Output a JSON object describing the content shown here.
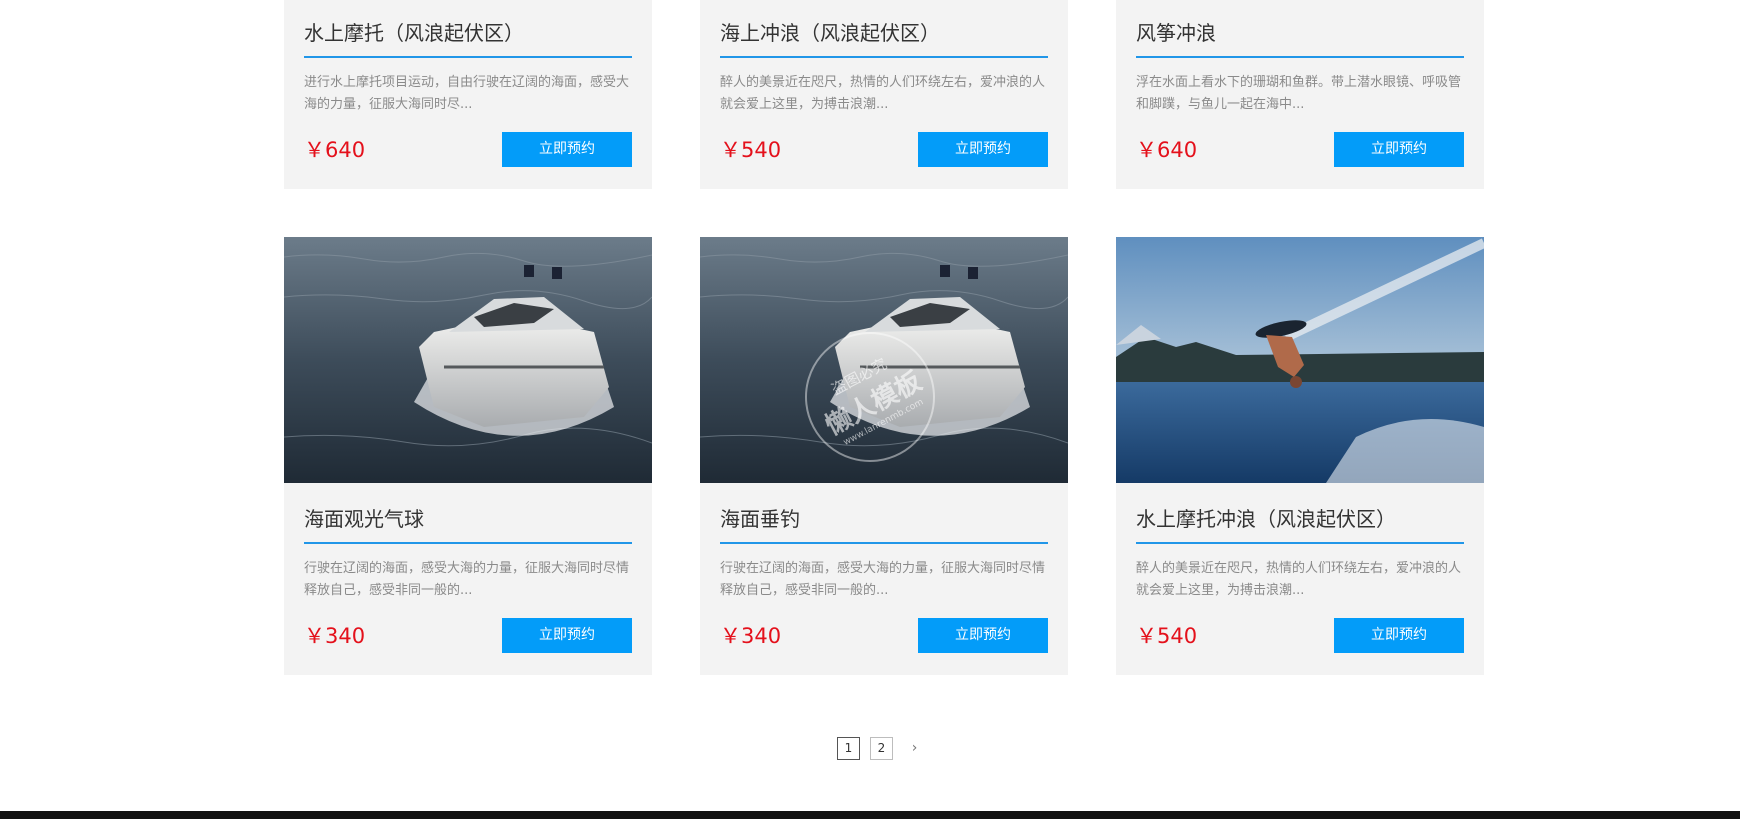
{
  "cards": [
    {
      "title": "水上摩托（风浪起伏区）",
      "desc": "进行水上摩托项目运动，自由行驶在辽阔的海面，感受大海的力量，征服大海同时尽...",
      "price": "￥640",
      "button": "立即预约"
    },
    {
      "title": "海上冲浪（风浪起伏区）",
      "desc": "醉人的美景近在咫尺，热情的人们环绕左右，爱冲浪的人就会爱上这里，为搏击浪潮...",
      "price": "￥540",
      "button": "立即预约"
    },
    {
      "title": "风筝冲浪",
      "desc": "浮在水面上看水下的珊瑚和鱼群。带上潜水眼镜、呼吸管和脚蹼，与鱼儿一起在海中...",
      "price": "￥640",
      "button": "立即预约"
    },
    {
      "title": "海面观光气球",
      "desc": "行驶在辽阔的海面，感受大海的力量，征服大海同时尽情释放自己，感受非同一般的...",
      "price": "￥340",
      "button": "立即预约"
    },
    {
      "title": "海面垂钓",
      "desc": "行驶在辽阔的海面，感受大海的力量，征服大海同时尽情释放自己，感受非同一般的...",
      "price": "￥340",
      "button": "立即预约"
    },
    {
      "title": "水上摩托冲浪（风浪起伏区）",
      "desc": "醉人的美景近在咫尺，热情的人们环绕左右，爱冲浪的人就会爱上这里，为搏击浪潮...",
      "price": "￥540",
      "button": "立即预约"
    }
  ],
  "watermark": {
    "line1": "盗图必究",
    "line2": "懒人模板",
    "line3": "www.lanrenmb.com"
  },
  "pagination": {
    "pages": [
      "1",
      "2"
    ],
    "current": "1",
    "next": "›"
  },
  "colors": {
    "accent": "#039cf9",
    "price": "#e4101b",
    "divider": "#2196e8"
  },
  "icons": {
    "next": "chevron-right-icon"
  }
}
